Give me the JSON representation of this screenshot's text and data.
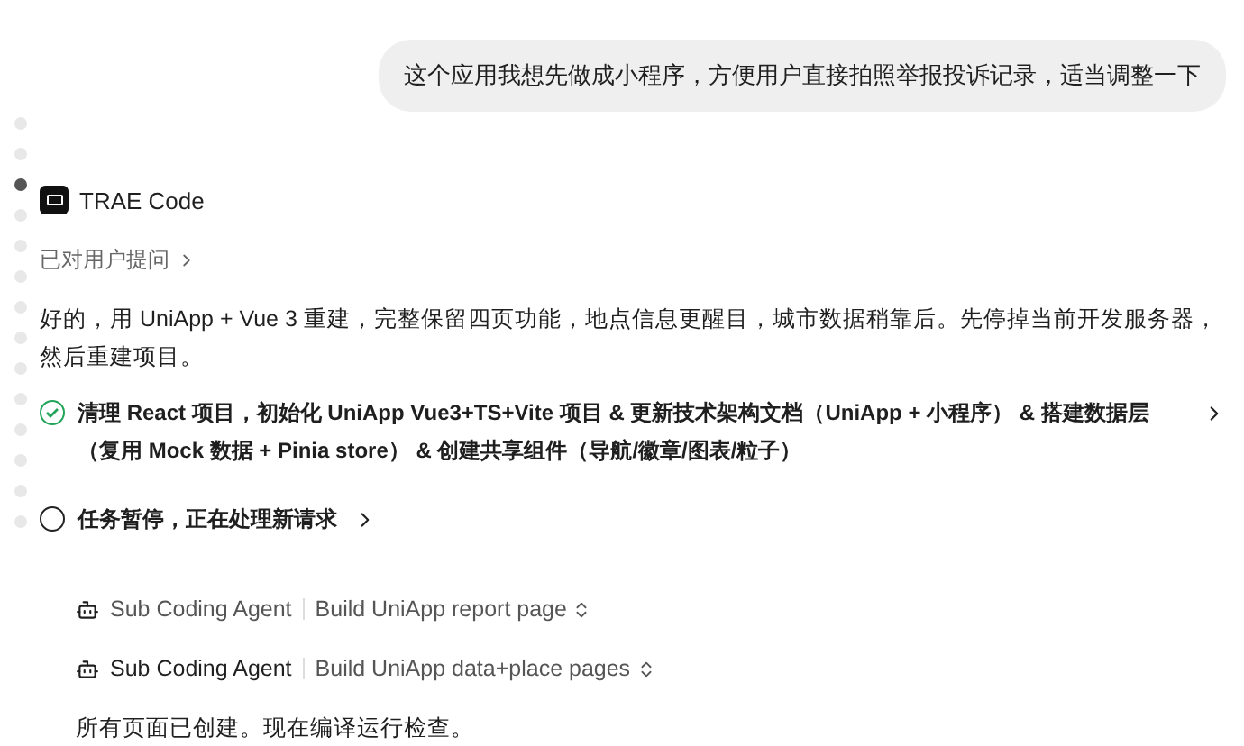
{
  "user_message": "这个应用我想先做成小程序，方便用户直接拍照举报投诉记录，适当调整一下",
  "nav_dots": [
    {
      "selected": false
    },
    {
      "selected": false
    },
    {
      "selected": true
    },
    {
      "selected": false
    },
    {
      "selected": false
    },
    {
      "selected": false
    },
    {
      "selected": false
    },
    {
      "selected": false
    },
    {
      "selected": false
    },
    {
      "selected": false
    },
    {
      "selected": false
    },
    {
      "selected": false
    },
    {
      "selected": false
    },
    {
      "selected": false
    }
  ],
  "agent": {
    "name": "TRAE Code"
  },
  "asked_user": "已对用户提问",
  "reply": "好的，用 UniApp + Vue 3 重建，完整保留四页功能，地点信息更醒目，城市数据稍靠后。先停掉当前开发服务器，然后重建项目。",
  "tasks": [
    {
      "text": "清理 React 项目，初始化 UniApp Vue3+TS+Vite 项目 & 更新技术架构文档（UniApp + 小程序） & 搭建数据层（复用 Mock 数据 + Pinia store） & 创建共享组件（导航/徽章/图表/粒子）",
      "checked": true
    },
    {
      "text": "任务暂停，正在处理新请求",
      "checked": false
    }
  ],
  "sub_agents": [
    {
      "agent": "Sub Coding Agent",
      "task": "Build UniApp report page"
    },
    {
      "agent": "Sub Coding Agent",
      "task": "Build UniApp data+place pages"
    }
  ],
  "status": "所有页面已创建。现在编译运行检查。"
}
